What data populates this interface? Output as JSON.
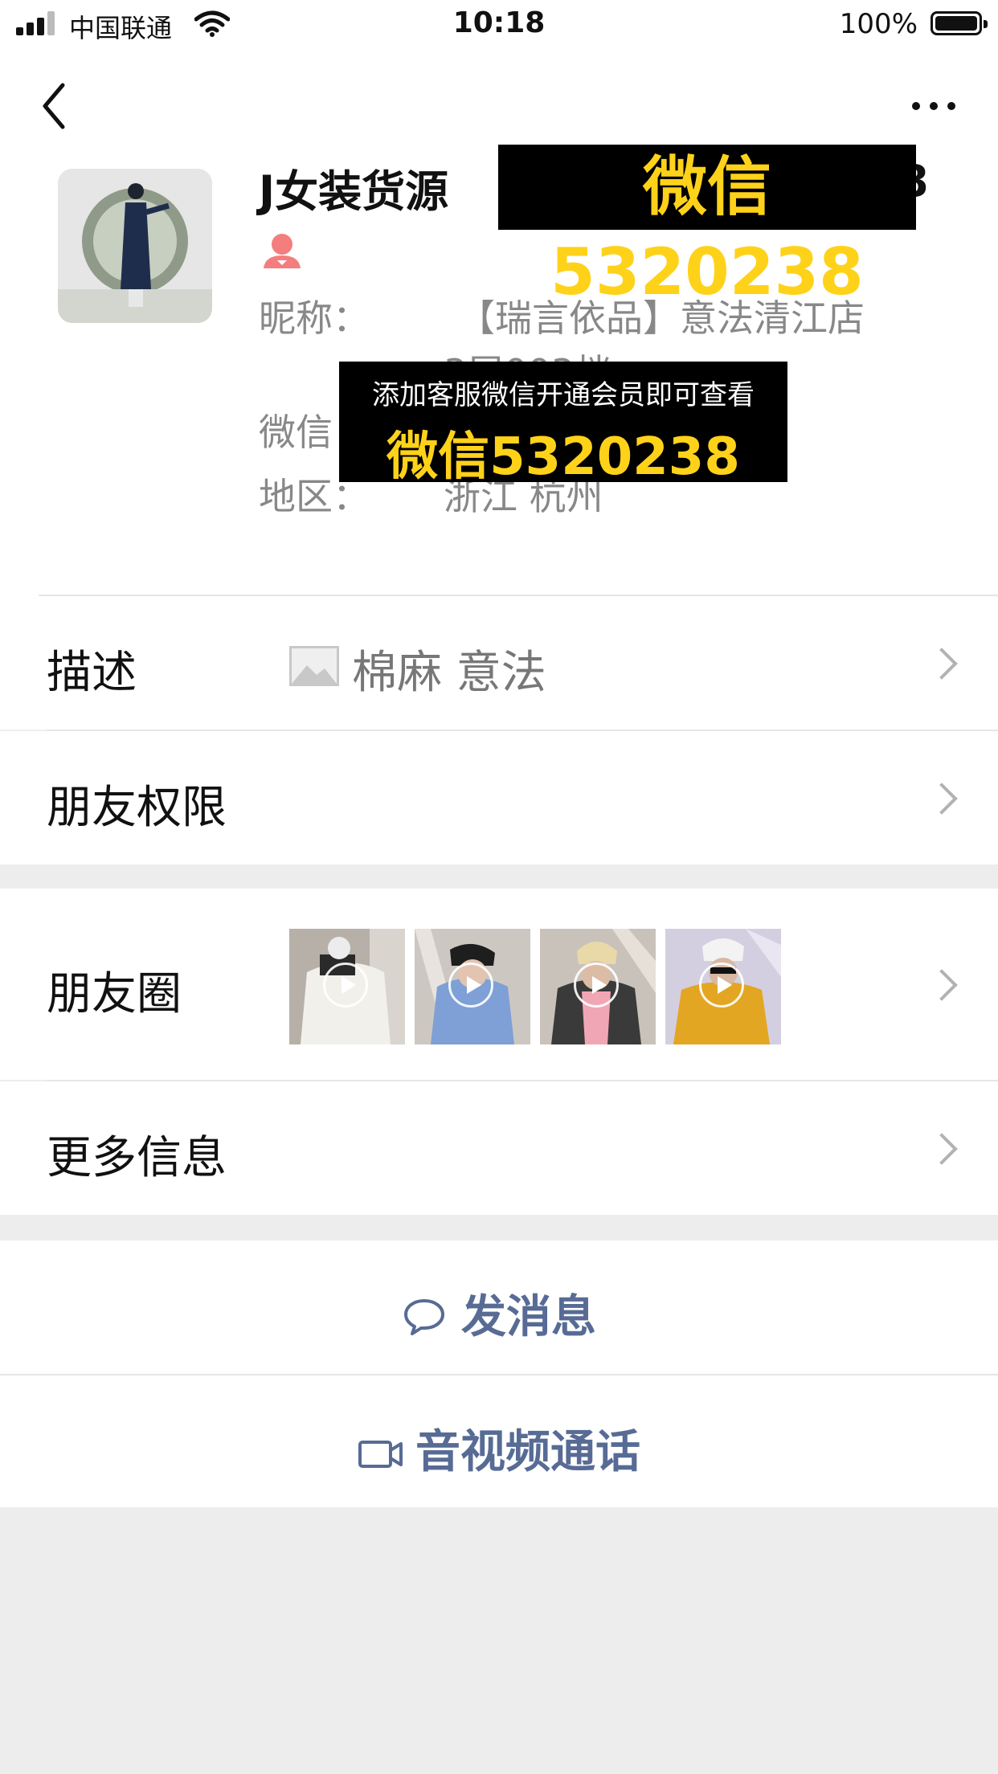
{
  "status_bar": {
    "carrier": "中国联通",
    "time": "10:18",
    "battery": "100%"
  },
  "profile": {
    "name": "J女装货源",
    "name_tail": "8",
    "nickname_label": "昵称：",
    "nickname_value": "【瑞言依品】意法清江店",
    "floor_partial": "3层003档",
    "wechat_label": "微信",
    "region_label": "地区：",
    "region_value": "浙江 杭州"
  },
  "watermark": {
    "top": "微信5320238",
    "overlay_line1": "添加客服微信开通会员即可查看",
    "overlay_line2": "微信5320238"
  },
  "rows": {
    "description_label": "描述",
    "description_value": "棉麻 意法",
    "permissions_label": "朋友权限",
    "moments_label": "朋友圈",
    "more_info_label": "更多信息"
  },
  "actions": {
    "message": "发消息",
    "call": "音视频通话"
  },
  "colors": {
    "link_blue": "#576b95",
    "female_icon": "#f37e7d",
    "watermark_yellow": "#ffd21a",
    "page_bg": "#ededed"
  },
  "icons": {
    "back": "chevron-left-icon",
    "more": "ellipsis-icon",
    "female": "female-icon",
    "image": "image-icon",
    "chat": "chat-bubble-icon",
    "video": "video-camera-icon",
    "play": "play-icon"
  }
}
